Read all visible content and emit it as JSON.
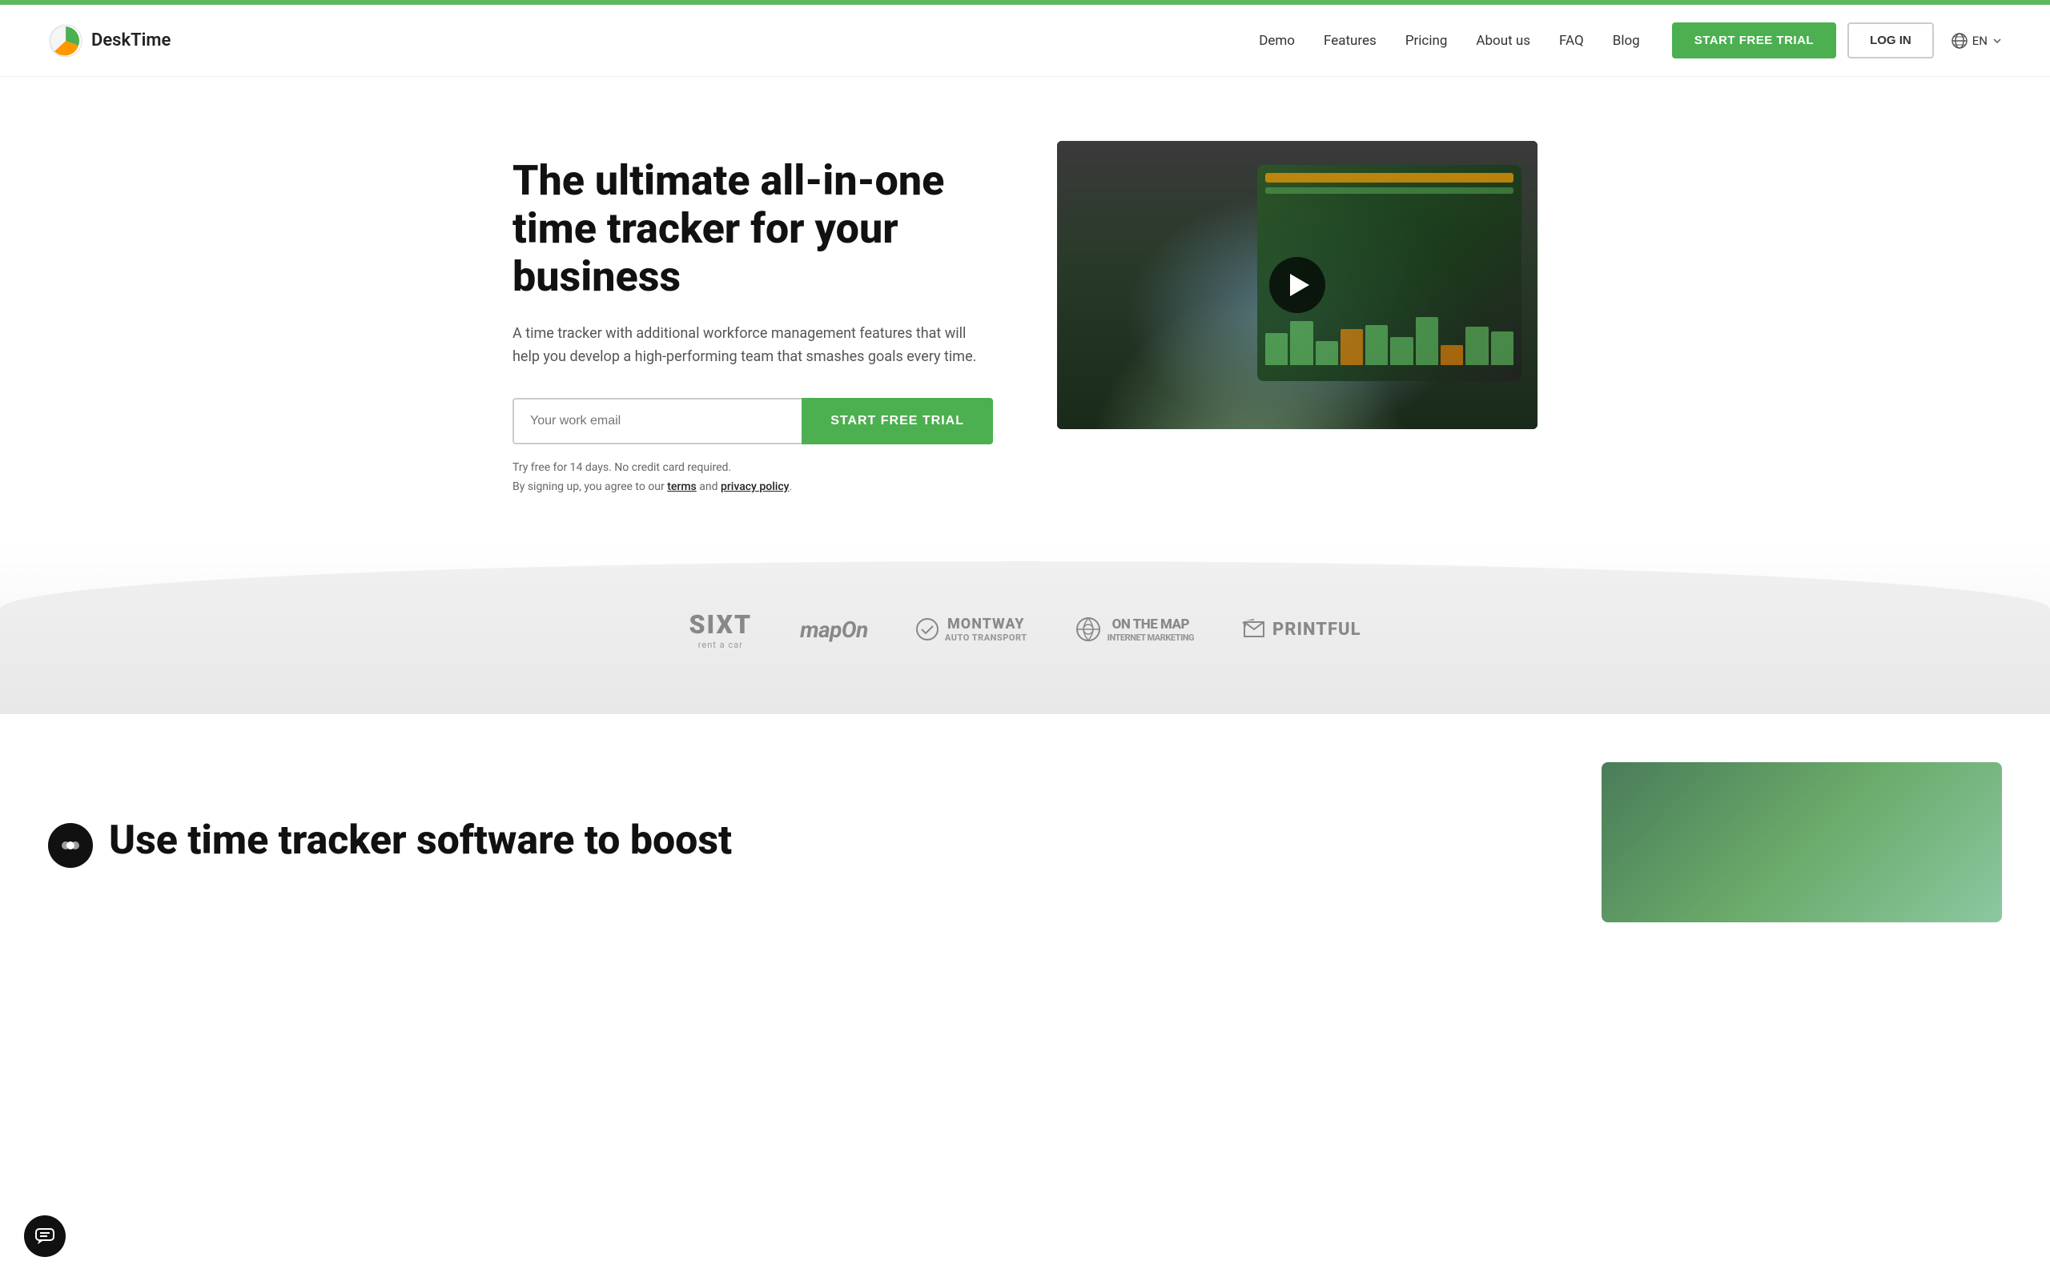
{
  "topBar": {},
  "nav": {
    "logo": {
      "text": "DeskTime"
    },
    "links": [
      {
        "label": "Demo",
        "id": "demo"
      },
      {
        "label": "Features",
        "id": "features"
      },
      {
        "label": "Pricing",
        "id": "pricing"
      },
      {
        "label": "About us",
        "id": "about"
      },
      {
        "label": "FAQ",
        "id": "faq"
      },
      {
        "label": "Blog",
        "id": "blog"
      }
    ],
    "ctaButton": "START FREE TRIAL",
    "loginButton": "LOG IN",
    "language": "EN"
  },
  "hero": {
    "title": "The ultimate all-in-one time tracker for your business",
    "subtitle": "A time tracker with additional workforce management features that will help you develop a high-performing team that smashes goals every time.",
    "emailPlaceholder": "Your work email",
    "ctaButton": "START FREE TRIAL",
    "finePrint1": "Try free for 14 days. No credit card required.",
    "finePrint2": "By signing up, you agree to our",
    "termsLink": "terms",
    "andText": "and",
    "privacyLink": "privacy policy",
    "finePrintEnd": "."
  },
  "partners": {
    "logos": [
      {
        "name": "SIXT",
        "subtitle": "rent a car",
        "style": "sixt"
      },
      {
        "name": "mapOn",
        "style": "mapon"
      },
      {
        "name": "MONTWAY AUTO TRANSPORT",
        "style": "montway"
      },
      {
        "name": "ON THE MAP INTERNET MARKETING",
        "style": "onthemap"
      },
      {
        "name": "PRINTFUL",
        "style": "printful"
      }
    ]
  },
  "bottomTeaser": {
    "title": "Use time tracker software to boost"
  },
  "chatBubble": {
    "icon": "💬"
  }
}
